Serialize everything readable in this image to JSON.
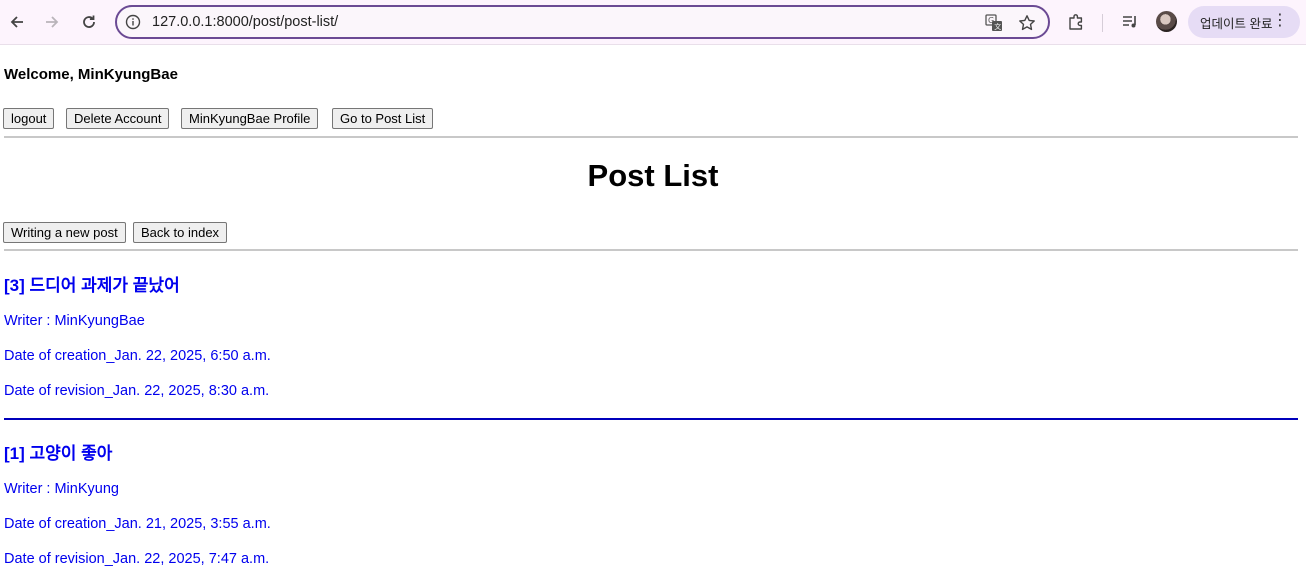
{
  "browser": {
    "url": "127.0.0.1:8000/post/post-list/",
    "update_label": "업데이트 완료"
  },
  "header": {
    "welcome": "Welcome, MinKyungBae",
    "buttons": {
      "logout": "logout",
      "delete": "Delete Account",
      "profile": "MinKyungBae Profile",
      "post_list": "Go to Post List"
    }
  },
  "main": {
    "title": "Post List",
    "write_label": "Writing a new post",
    "back_label": "Back to index",
    "posts": [
      {
        "title": "[3] 드디어 과제가 끝났어",
        "writer": "Writer : MinKyungBae",
        "created": "Date of creation_Jan. 22, 2025, 6:50 a.m.",
        "revised": "Date of revision_Jan. 22, 2025, 8:30 a.m."
      },
      {
        "title": "[1] 고양이 좋아",
        "writer": "Writer : MinKyung",
        "created": "Date of creation_Jan. 21, 2025, 3:55 a.m.",
        "revised": "Date of revision_Jan. 22, 2025, 7:47 a.m."
      }
    ]
  }
}
